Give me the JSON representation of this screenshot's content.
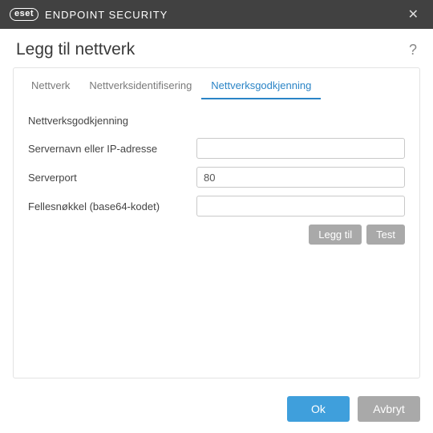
{
  "titlebar": {
    "logo_text": "eset",
    "product": "ENDPOINT SECURITY"
  },
  "header": {
    "title": "Legg til nettverk"
  },
  "tabs": {
    "items": [
      {
        "label": "Nettverk"
      },
      {
        "label": "Nettverksidentifisering"
      },
      {
        "label": "Nettverksgodkjenning"
      }
    ],
    "active_index": 2
  },
  "form": {
    "section_title": "Nettverksgodkjenning",
    "server_name_label": "Servernavn eller IP-adresse",
    "server_name_value": "",
    "server_port_label": "Serverport",
    "server_port_value": "80",
    "shared_key_label": "Fellesnøkkel (base64-kodet)",
    "shared_key_value": ""
  },
  "actions": {
    "add_label": "Legg til",
    "test_label": "Test"
  },
  "footer": {
    "ok_label": "Ok",
    "cancel_label": "Avbryt"
  }
}
